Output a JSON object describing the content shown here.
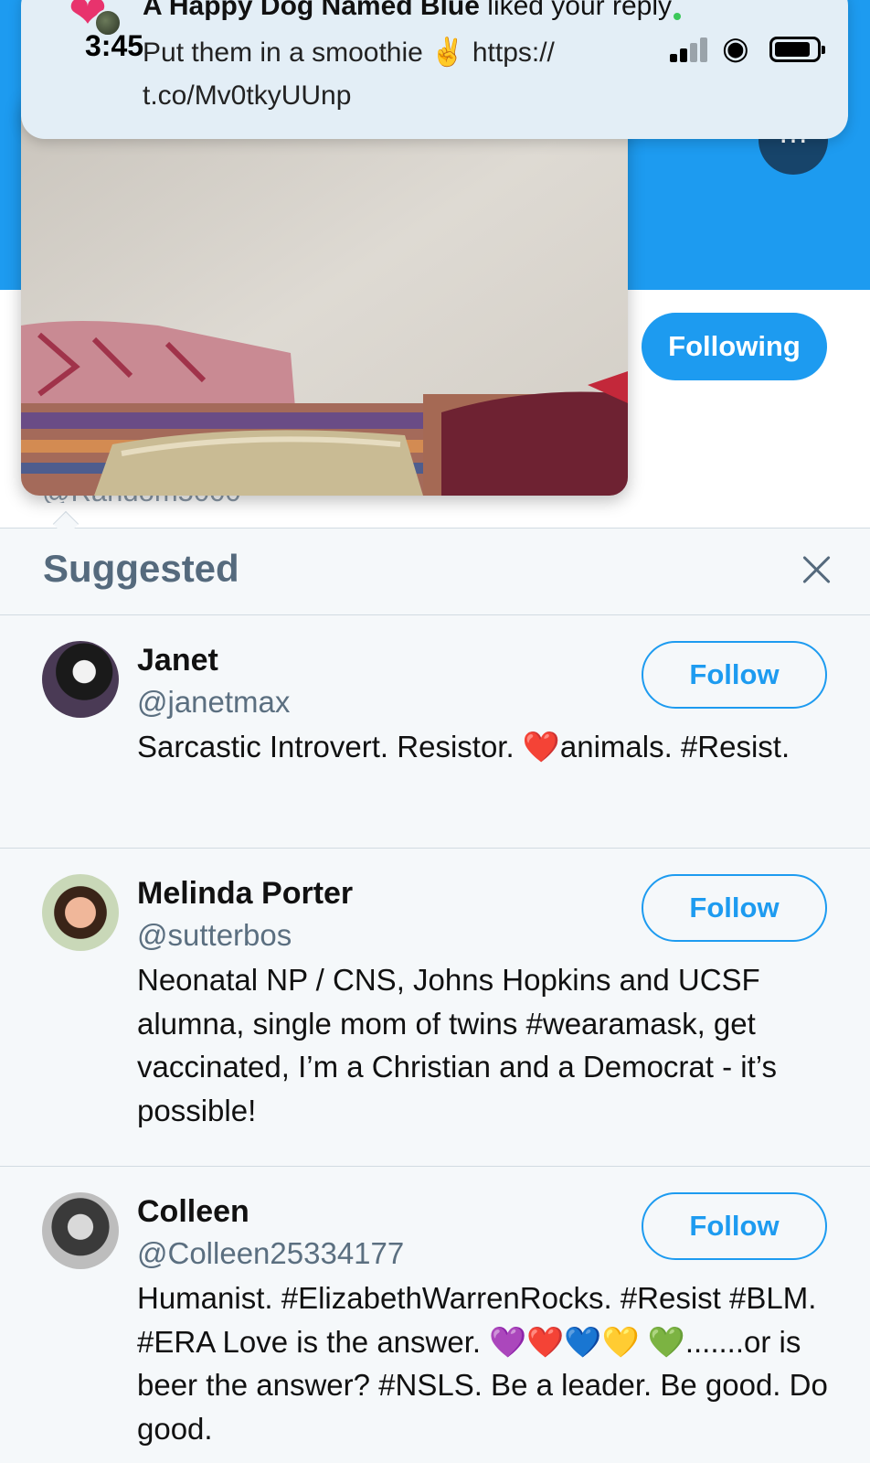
{
  "status_bar": {
    "time": "3:45"
  },
  "notification": {
    "title_bold": "A Happy Dog Named Blue",
    "title_rest": " liked your reply",
    "body_line1": "Put them in a smoothie ✌️  https://",
    "body_line2": "t.co/Mv0tkyUUnp"
  },
  "profile": {
    "following_label": "Following",
    "more_label": "…",
    "handle_peek": "@Random5000"
  },
  "suggested": {
    "title": "Suggested",
    "users": [
      {
        "name": "Janet",
        "handle": "@janetmax",
        "bio": "Sarcastic Introvert. Resistor. ❤️animals. #Resist.",
        "follow_label": "Follow"
      },
      {
        "name": "Melinda Porter",
        "handle": "@sutterbos",
        "bio": "Neonatal NP / CNS, Johns Hopkins and UCSF alumna, single mom of twins #wearamask, get vaccinated, I’m a Christian and a Democrat - it’s possible!",
        "follow_label": "Follow"
      },
      {
        "name": "Colleen",
        "handle": "@Colleen25334177",
        "bio": "Humanist. #ElizabethWarrenRocks. #Resist #BLM. #ERA Love is the answer. 💜❤️💙💛 💚.......or is beer the answer? #NSLS. Be a leader. Be good. Do good.",
        "follow_label": "Follow"
      }
    ]
  },
  "colors": {
    "accent": "#1d9bf0",
    "text_secondary": "#5b6f80",
    "background": "#f5f8fa"
  },
  "icons": [
    "heart-icon",
    "close-icon",
    "signal-icon",
    "wifi-icon",
    "battery-icon",
    "more-icon"
  ]
}
